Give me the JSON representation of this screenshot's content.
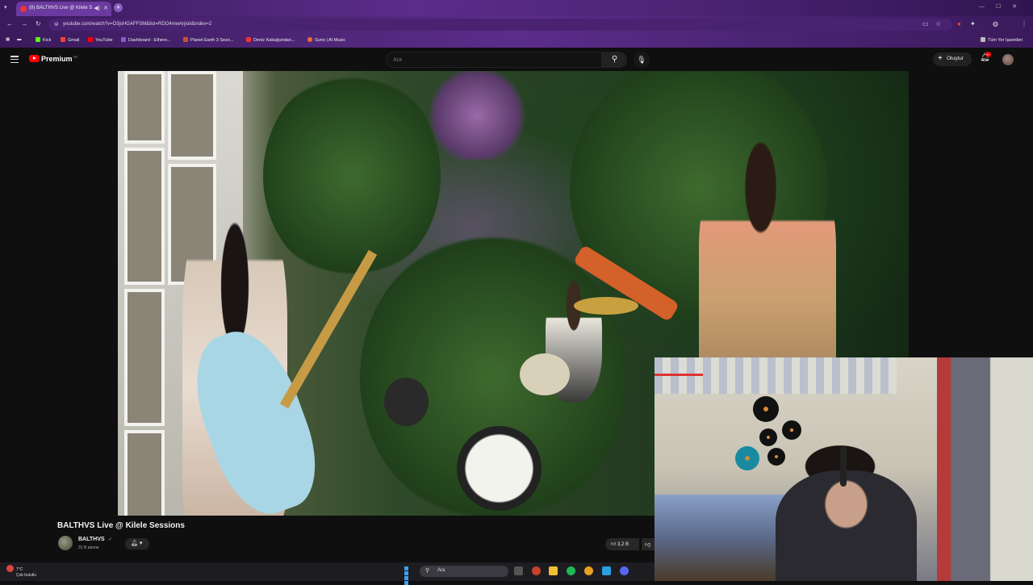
{
  "browser": {
    "tab_title": "(8) BALTHVS Live @ Kilele S",
    "url": "youtube.com/watch?v=O3jsHGAFFSM&list=RDO4mwArjioiI&index=2",
    "bookmarks": [
      "Kick",
      "Gmail",
      "YouTube",
      "Dashboard - Ethere...",
      "Planet Earth 3 Sezo...",
      "Deniz Kabuğundan...",
      "Suno | AI Music"
    ],
    "all_bookmarks": "Tüm Yer İşaretleri"
  },
  "youtube": {
    "logo_text": "Premium",
    "logo_country": "TR",
    "search_placeholder": "Ara",
    "create_label": "Oluştur",
    "notification_count": "9+"
  },
  "video": {
    "title": "BALTHVS Live @ Kilele Sessions",
    "channel": "BALTHVS",
    "verified": "✓",
    "subscribers": "31 B abone",
    "likes": "3,2 B"
  },
  "taskbar": {
    "weather_temp": "7°C",
    "weather_desc": "Çok bulutlu",
    "search_label": "Ara"
  },
  "colors": {
    "accent": "#ff0000",
    "chrome_purple": "#5b2d8a",
    "yt_bg": "#0f0f0f"
  }
}
